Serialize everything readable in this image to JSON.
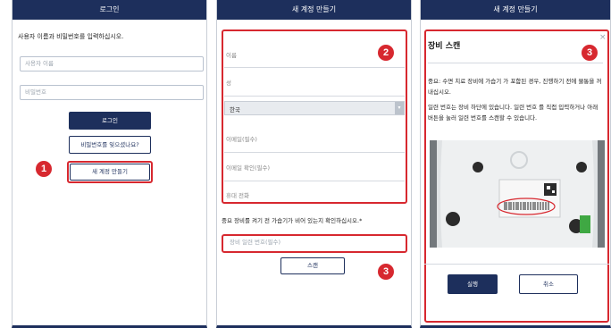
{
  "screen1": {
    "header": "로그인",
    "instruction": "사용자 이름과 비밀번호를 입력하십시오.",
    "username_placeholder": "사용자 이름",
    "password_placeholder": "비밀번호",
    "login_button": "로그인",
    "forgot_password_button": "비밀번호를 잊으셨나요?",
    "create_account_button": "새 계정 만들기",
    "step_marker": "1"
  },
  "screen2": {
    "header": "새 계정 만들기",
    "fields": [
      "이름",
      "성",
      "한국",
      "이메일(필수)",
      "이메일 확인(필수)",
      "휴대 전화"
    ],
    "notice": "중요 장비를 켜기 전 가습기가 비어 있는지 확인하십시오.*",
    "serial_placeholder": "장비 일련 번호(필수)",
    "scan_button": "스캔",
    "step_marker_top": "2",
    "step_marker_bottom": "3"
  },
  "screen3": {
    "header": "새 계정 만들기",
    "dialog_title": "장비 스캔",
    "close_symbol": "×",
    "paragraph1": "중요: 수면 치료 장비에 가습기 가 포함된 경우, 진행하기 전에 물통을 꺼내십시오.",
    "paragraph2": "일련 번호는 장비 하단에 있습니다. 일련 번호 를 직접 입력하거나 아래 버튼을 눌러 일련 번호를 스캔할 수 있습니다.",
    "run_button": "실행",
    "cancel_button": "취소",
    "step_marker": "3"
  },
  "colors": {
    "navy": "#1d2f5c",
    "red": "#d7282f"
  }
}
